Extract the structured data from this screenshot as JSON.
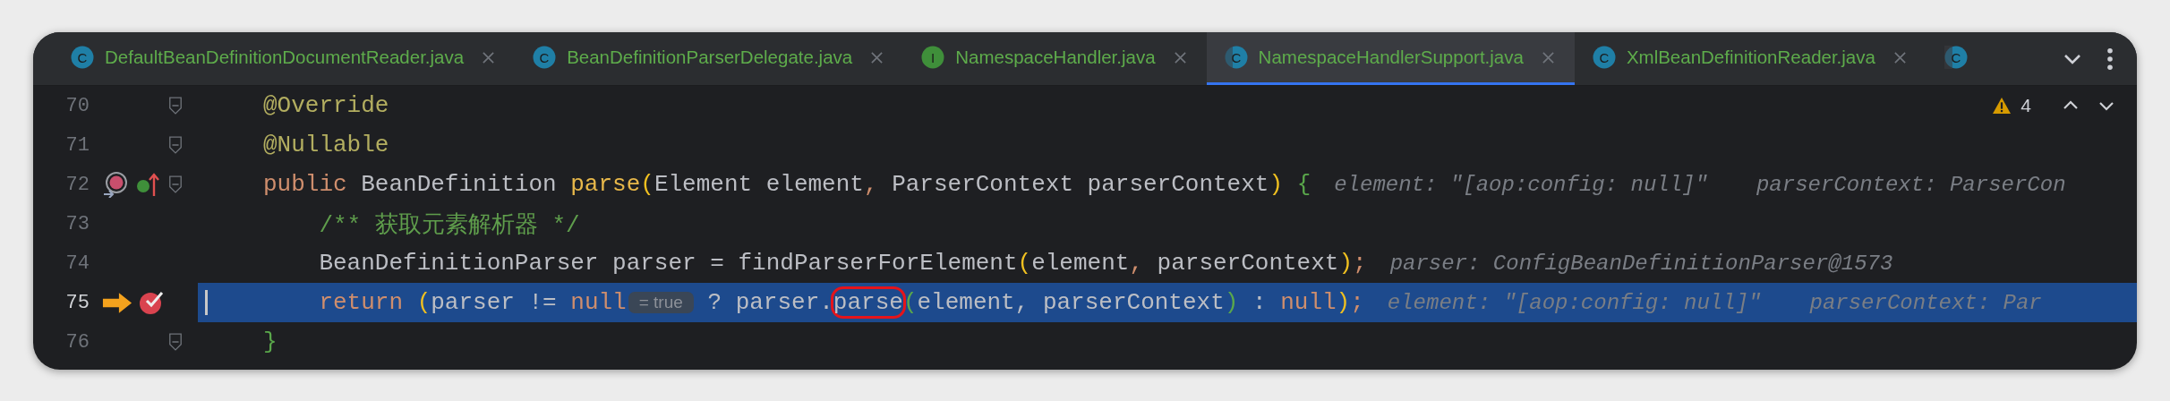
{
  "tabs": [
    {
      "kind": "class",
      "icon_letter": "C",
      "label": "DefaultBeanDefinitionDocumentReader.java",
      "selected": false
    },
    {
      "kind": "class",
      "icon_letter": "C",
      "label": "BeanDefinitionParserDelegate.java",
      "selected": false
    },
    {
      "kind": "interface",
      "icon_letter": "I",
      "label": "NamespaceHandler.java",
      "selected": false
    },
    {
      "kind": "abstract",
      "icon_letter": "C",
      "label": "NamespaceHandlerSupport.java",
      "selected": true
    },
    {
      "kind": "class",
      "icon_letter": "C",
      "label": "XmlBeanDefinitionReader.java",
      "selected": false
    },
    {
      "kind": "abstract",
      "icon_letter": "C",
      "selected": false
    }
  ],
  "inspections": {
    "count": "4"
  },
  "lines": [
    {
      "number": "70",
      "current": false,
      "caret": false,
      "fold": true,
      "tokens": [
        {
          "kind": "annotation",
          "text": "@Override"
        }
      ]
    },
    {
      "number": "71",
      "current": false,
      "caret": false,
      "fold": true,
      "tokens": [
        {
          "kind": "annotation",
          "text": "@Nullable"
        }
      ]
    },
    {
      "number": "72",
      "current": false,
      "caret": false,
      "fold": true,
      "gutter": [
        {
          "kind": "implements"
        },
        {
          "kind": "overrides"
        }
      ],
      "tokens": [
        {
          "kind": "keyword",
          "text": "public"
        },
        {
          "kind": "plain",
          "text": " BeanDefinition "
        },
        {
          "kind": "decl",
          "text": "parse"
        },
        {
          "kind": "bracket_gold",
          "text": "("
        },
        {
          "kind": "plain",
          "text": "Element element"
        },
        {
          "kind": "punct",
          "text": ","
        },
        {
          "kind": "plain",
          "text": " ParserContext parserContext"
        },
        {
          "kind": "bracket_gold",
          "text": ")"
        },
        {
          "kind": "bracket_green",
          "text": " {"
        }
      ],
      "hints": [
        "element: \"[aop:config: null]\"",
        "parserContext: ParserCon"
      ]
    },
    {
      "number": "73",
      "current": false,
      "caret": false,
      "fold": false,
      "tokens": [
        {
          "kind": "comment",
          "text": "    /** 获取元素解析器 */"
        }
      ]
    },
    {
      "number": "74",
      "current": false,
      "caret": false,
      "fold": false,
      "tokens": [
        {
          "kind": "plain",
          "text": "    BeanDefinitionParser parser = findParserForElement"
        },
        {
          "kind": "bracket_gold",
          "text": "("
        },
        {
          "kind": "plain",
          "text": "element"
        },
        {
          "kind": "punct",
          "text": ","
        },
        {
          "kind": "plain",
          "text": " parserContext"
        },
        {
          "kind": "bracket_gold",
          "text": ")"
        },
        {
          "kind": "punct",
          "text": ";"
        }
      ],
      "hints": [
        "parser: ConfigBeanDefinitionParser@1573"
      ]
    },
    {
      "number": "75",
      "current": true,
      "caret": true,
      "fold": false,
      "gutter": [
        {
          "kind": "execution"
        },
        {
          "kind": "breakpoint"
        }
      ],
      "tokens": [
        {
          "kind": "keyword",
          "text": "    return "
        },
        {
          "kind": "bracket_gold",
          "text": "("
        },
        {
          "kind": "plain",
          "text": "parser != "
        },
        {
          "kind": "keyword",
          "text": "null"
        },
        {
          "kind": "inlay",
          "text": "= true"
        },
        {
          "kind": "plain",
          "text": " ? parser."
        },
        {
          "kind": "circled",
          "text": "parse"
        },
        {
          "kind": "bracket_green",
          "text": "("
        },
        {
          "kind": "plain",
          "text": "element, parserContext"
        },
        {
          "kind": "bracket_green",
          "text": ")"
        },
        {
          "kind": "plain",
          "text": " : "
        },
        {
          "kind": "keyword",
          "text": "null"
        },
        {
          "kind": "bracket_gold",
          "text": ")"
        },
        {
          "kind": "punct",
          "text": ";"
        }
      ],
      "hints": [
        "element: \"[aop:config: null]\"",
        "parserContext: Par"
      ]
    },
    {
      "number": "76",
      "current": false,
      "caret": false,
      "fold": true,
      "tokens": [
        {
          "kind": "bracket_green",
          "text": "}"
        }
      ]
    }
  ]
}
